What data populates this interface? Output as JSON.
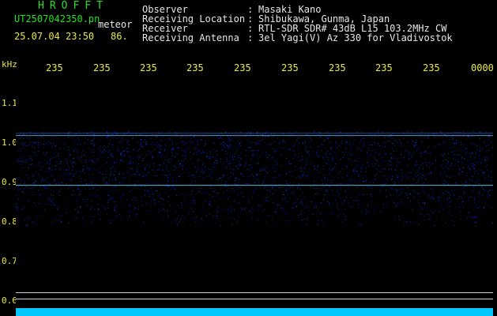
{
  "header": {
    "title": "HROFFT",
    "filename": "UT2507042350.pn",
    "filename_suffix": "meteor",
    "datetime": "25.07.04 23:50",
    "number": "86."
  },
  "info": [
    {
      "label": "Observer",
      "value": "Masaki Kano"
    },
    {
      "label": "Receiving Location",
      "value": "Shibukawa, Gunma, Japan"
    },
    {
      "label": "Receiver",
      "value": "RTL-SDR SDR# 43dB L15 103.2MHz CW"
    },
    {
      "label": "Receiving Antenna",
      "value": "3el Yagi(V) Az 330 for Vladivostok"
    }
  ],
  "axis": {
    "y_unit": "kHz",
    "y_labels": [
      "1.1",
      "1.0",
      "0.9",
      "0.8",
      "0.7",
      "0.6"
    ],
    "x_labels": [
      "235",
      "235",
      "235",
      "235",
      "235",
      "235",
      "235",
      "235",
      "235",
      "0000"
    ]
  },
  "colors": {
    "title": "#22e022",
    "label": "#e8e848",
    "text": "#e6e6e6",
    "signal": "#1030c0",
    "strip": "#00c8ff"
  }
}
